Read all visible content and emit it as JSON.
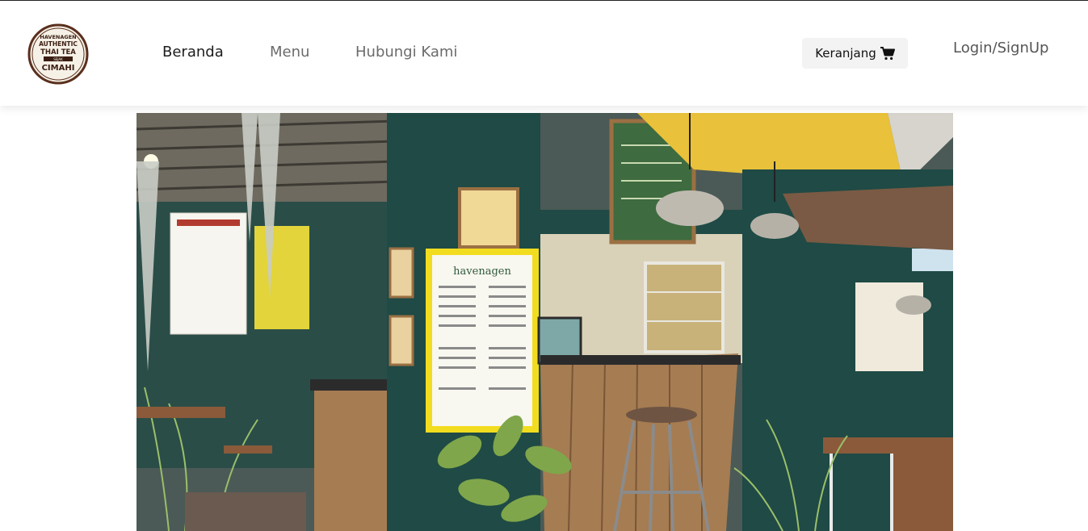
{
  "header": {
    "logo": {
      "line1": "HAVENAGEN",
      "line2": "AUTHENTIC",
      "line3": "THAI TEA",
      "line4": "SEJAK",
      "line5": "CIMAHI",
      "ring_color": "#5a2f1e"
    },
    "nav": [
      {
        "label": "Beranda",
        "active": true
      },
      {
        "label": "Menu",
        "active": false
      },
      {
        "label": "Hubungi Kami",
        "active": false
      }
    ],
    "cart": {
      "label": "Keranjang",
      "icon": "cart-icon"
    },
    "login": {
      "label": "Login/SignUp"
    }
  },
  "hero": {
    "description": "Havenagen storefront photo",
    "sign_text": "havenagen",
    "colors": {
      "wall": "#1f4a45",
      "awning": "#e9c13a",
      "wood": "#a67c52",
      "menu_frame": "#f2dc1f"
    }
  }
}
